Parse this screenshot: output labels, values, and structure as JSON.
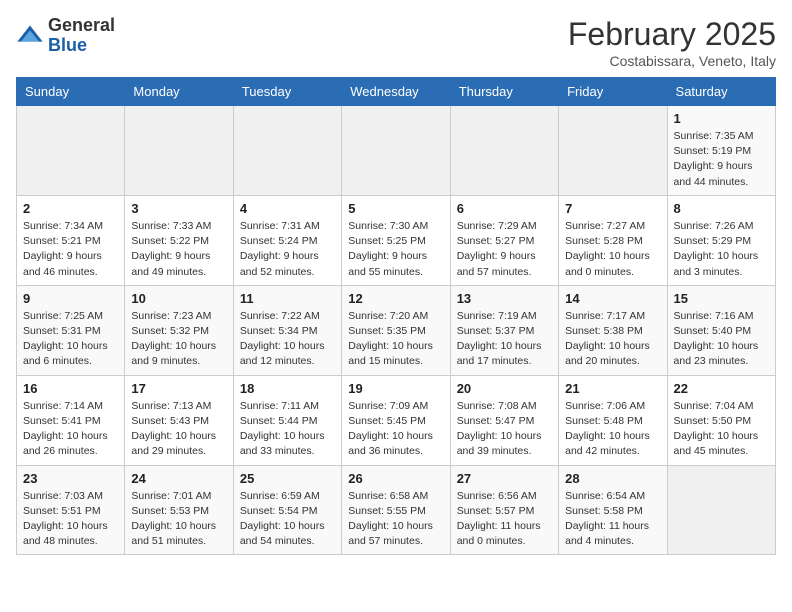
{
  "header": {
    "logo_general": "General",
    "logo_blue": "Blue",
    "month_title": "February 2025",
    "location": "Costabissara, Veneto, Italy"
  },
  "days_of_week": [
    "Sunday",
    "Monday",
    "Tuesday",
    "Wednesday",
    "Thursday",
    "Friday",
    "Saturday"
  ],
  "weeks": [
    [
      {
        "day": "",
        "info": ""
      },
      {
        "day": "",
        "info": ""
      },
      {
        "day": "",
        "info": ""
      },
      {
        "day": "",
        "info": ""
      },
      {
        "day": "",
        "info": ""
      },
      {
        "day": "",
        "info": ""
      },
      {
        "day": "1",
        "info": "Sunrise: 7:35 AM\nSunset: 5:19 PM\nDaylight: 9 hours and 44 minutes."
      }
    ],
    [
      {
        "day": "2",
        "info": "Sunrise: 7:34 AM\nSunset: 5:21 PM\nDaylight: 9 hours and 46 minutes."
      },
      {
        "day": "3",
        "info": "Sunrise: 7:33 AM\nSunset: 5:22 PM\nDaylight: 9 hours and 49 minutes."
      },
      {
        "day": "4",
        "info": "Sunrise: 7:31 AM\nSunset: 5:24 PM\nDaylight: 9 hours and 52 minutes."
      },
      {
        "day": "5",
        "info": "Sunrise: 7:30 AM\nSunset: 5:25 PM\nDaylight: 9 hours and 55 minutes."
      },
      {
        "day": "6",
        "info": "Sunrise: 7:29 AM\nSunset: 5:27 PM\nDaylight: 9 hours and 57 minutes."
      },
      {
        "day": "7",
        "info": "Sunrise: 7:27 AM\nSunset: 5:28 PM\nDaylight: 10 hours and 0 minutes."
      },
      {
        "day": "8",
        "info": "Sunrise: 7:26 AM\nSunset: 5:29 PM\nDaylight: 10 hours and 3 minutes."
      }
    ],
    [
      {
        "day": "9",
        "info": "Sunrise: 7:25 AM\nSunset: 5:31 PM\nDaylight: 10 hours and 6 minutes."
      },
      {
        "day": "10",
        "info": "Sunrise: 7:23 AM\nSunset: 5:32 PM\nDaylight: 10 hours and 9 minutes."
      },
      {
        "day": "11",
        "info": "Sunrise: 7:22 AM\nSunset: 5:34 PM\nDaylight: 10 hours and 12 minutes."
      },
      {
        "day": "12",
        "info": "Sunrise: 7:20 AM\nSunset: 5:35 PM\nDaylight: 10 hours and 15 minutes."
      },
      {
        "day": "13",
        "info": "Sunrise: 7:19 AM\nSunset: 5:37 PM\nDaylight: 10 hours and 17 minutes."
      },
      {
        "day": "14",
        "info": "Sunrise: 7:17 AM\nSunset: 5:38 PM\nDaylight: 10 hours and 20 minutes."
      },
      {
        "day": "15",
        "info": "Sunrise: 7:16 AM\nSunset: 5:40 PM\nDaylight: 10 hours and 23 minutes."
      }
    ],
    [
      {
        "day": "16",
        "info": "Sunrise: 7:14 AM\nSunset: 5:41 PM\nDaylight: 10 hours and 26 minutes."
      },
      {
        "day": "17",
        "info": "Sunrise: 7:13 AM\nSunset: 5:43 PM\nDaylight: 10 hours and 29 minutes."
      },
      {
        "day": "18",
        "info": "Sunrise: 7:11 AM\nSunset: 5:44 PM\nDaylight: 10 hours and 33 minutes."
      },
      {
        "day": "19",
        "info": "Sunrise: 7:09 AM\nSunset: 5:45 PM\nDaylight: 10 hours and 36 minutes."
      },
      {
        "day": "20",
        "info": "Sunrise: 7:08 AM\nSunset: 5:47 PM\nDaylight: 10 hours and 39 minutes."
      },
      {
        "day": "21",
        "info": "Sunrise: 7:06 AM\nSunset: 5:48 PM\nDaylight: 10 hours and 42 minutes."
      },
      {
        "day": "22",
        "info": "Sunrise: 7:04 AM\nSunset: 5:50 PM\nDaylight: 10 hours and 45 minutes."
      }
    ],
    [
      {
        "day": "23",
        "info": "Sunrise: 7:03 AM\nSunset: 5:51 PM\nDaylight: 10 hours and 48 minutes."
      },
      {
        "day": "24",
        "info": "Sunrise: 7:01 AM\nSunset: 5:53 PM\nDaylight: 10 hours and 51 minutes."
      },
      {
        "day": "25",
        "info": "Sunrise: 6:59 AM\nSunset: 5:54 PM\nDaylight: 10 hours and 54 minutes."
      },
      {
        "day": "26",
        "info": "Sunrise: 6:58 AM\nSunset: 5:55 PM\nDaylight: 10 hours and 57 minutes."
      },
      {
        "day": "27",
        "info": "Sunrise: 6:56 AM\nSunset: 5:57 PM\nDaylight: 11 hours and 0 minutes."
      },
      {
        "day": "28",
        "info": "Sunrise: 6:54 AM\nSunset: 5:58 PM\nDaylight: 11 hours and 4 minutes."
      },
      {
        "day": "",
        "info": ""
      }
    ]
  ]
}
